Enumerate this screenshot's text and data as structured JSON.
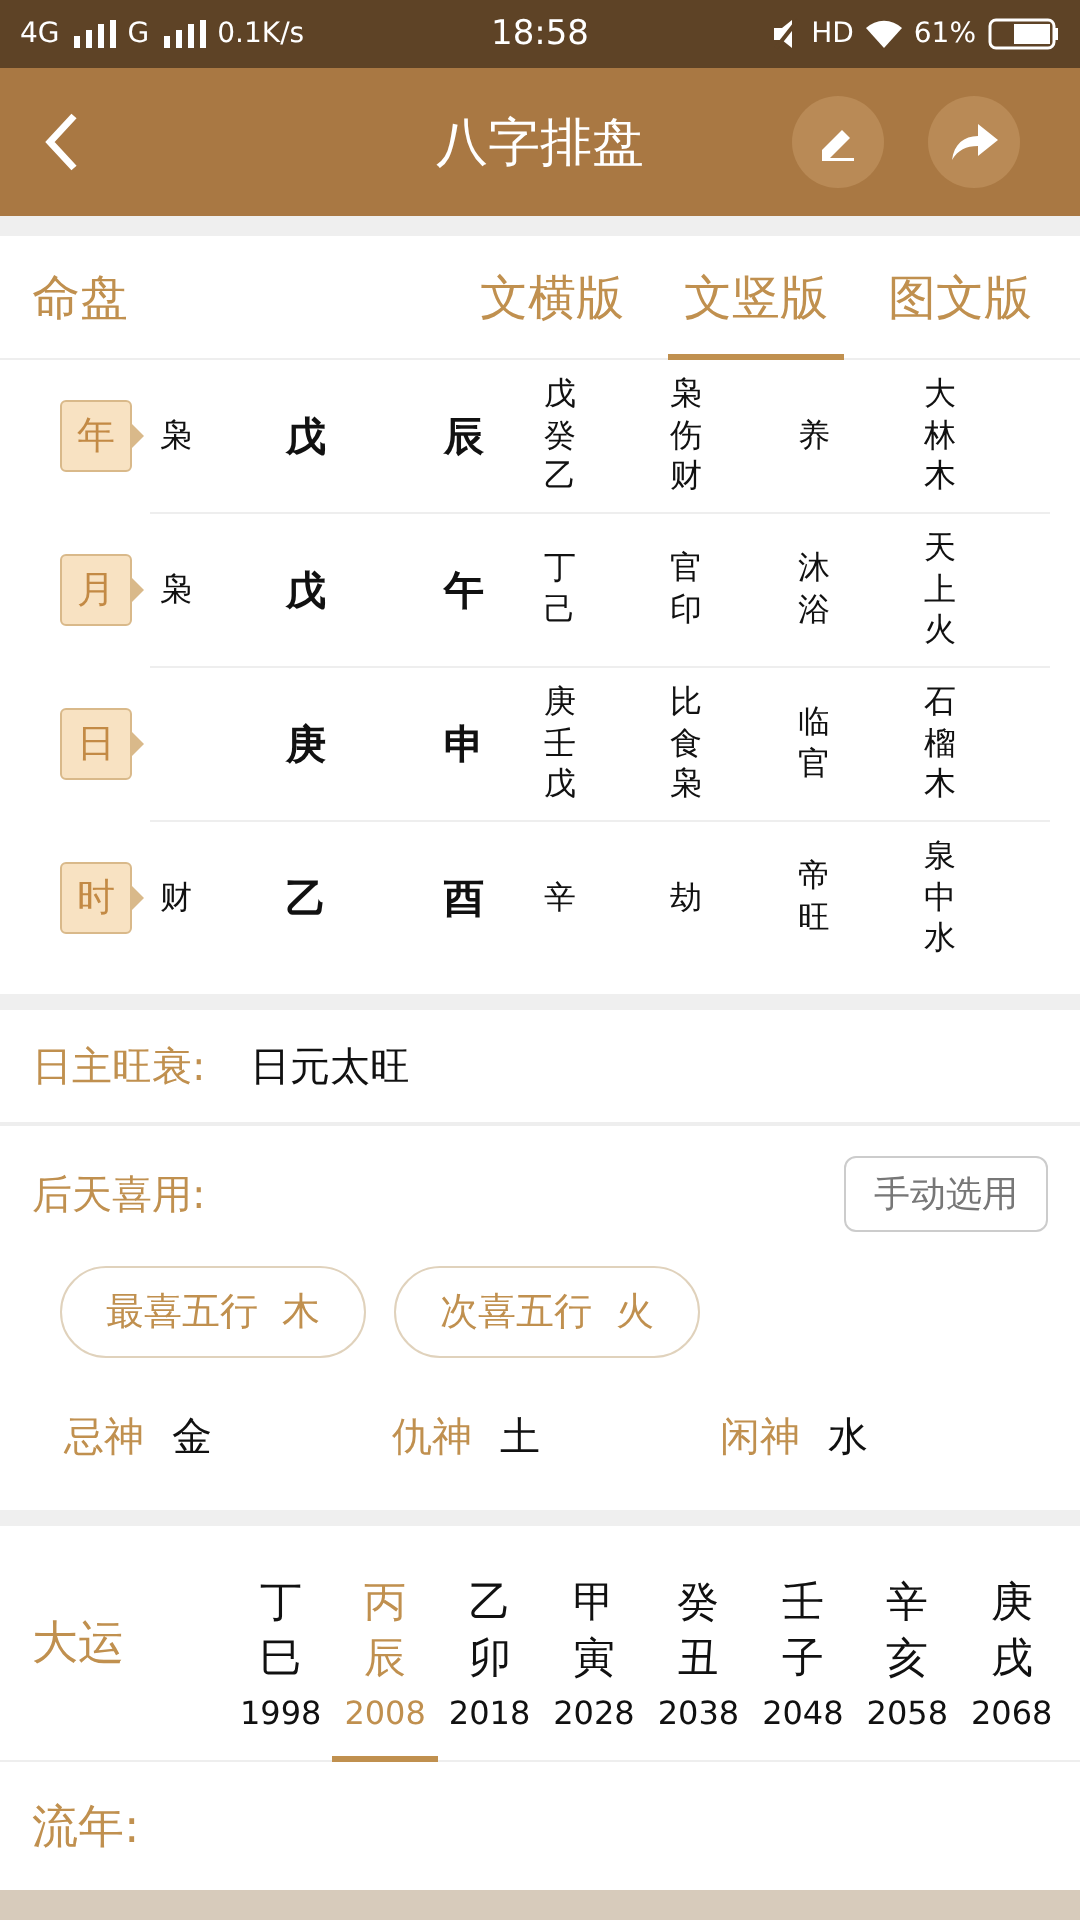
{
  "status_bar": {
    "network_1": "4G",
    "network_2": "G",
    "speed": "0.1K/s",
    "time": "18:58",
    "hd": "HD",
    "battery": "61%"
  },
  "header": {
    "title": "八字排盘"
  },
  "tabs": {
    "label": "命盘",
    "items": [
      {
        "label": "文横版",
        "selected": false
      },
      {
        "label": "文竖版",
        "selected": true
      },
      {
        "label": "图文版",
        "selected": false
      }
    ]
  },
  "chart": {
    "rows": [
      {
        "pillar": "年",
        "stem_god": "枭",
        "stem": "戊",
        "branch": "辰",
        "hidden_stems": "戊癸乙",
        "hidden_gods": "枭伤财",
        "growth": "养",
        "nayin": "大林木"
      },
      {
        "pillar": "月",
        "stem_god": "枭",
        "stem": "戊",
        "branch": "午",
        "hidden_stems": "丁己",
        "hidden_gods": "官印",
        "growth": "沐浴",
        "nayin": "天上火"
      },
      {
        "pillar": "日",
        "stem": "庚",
        "branch": "申",
        "hidden_stems": "庚壬戊",
        "hidden_gods": "比食枭",
        "growth": "临官",
        "nayin": "石榴木"
      },
      {
        "pillar": "时",
        "stem_god": "财",
        "stem": "乙",
        "branch": "酉",
        "hidden_stems": "辛",
        "hidden_gods": "劫",
        "growth": "帝旺",
        "nayin": "泉中水"
      }
    ]
  },
  "strength": {
    "label": "日主旺衰:",
    "value": "日元太旺"
  },
  "favorable": {
    "label": "后天喜用:",
    "button": "手动选用",
    "pills": [
      {
        "label": "最喜五行",
        "value": "木"
      },
      {
        "label": "次喜五行",
        "value": "火"
      }
    ],
    "gods": [
      {
        "label": "忌神",
        "value": "金"
      },
      {
        "label": "仇神",
        "value": "土"
      },
      {
        "label": "闲神",
        "value": "水"
      }
    ]
  },
  "dayun": {
    "label": "大运",
    "items": [
      {
        "stem": "丁",
        "branch": "巳",
        "year": "1998",
        "selected": false
      },
      {
        "stem": "丙",
        "branch": "辰",
        "year": "2008",
        "selected": true
      },
      {
        "stem": "乙",
        "branch": "卯",
        "year": "2018",
        "selected": false
      },
      {
        "stem": "甲",
        "branch": "寅",
        "year": "2028",
        "selected": false
      },
      {
        "stem": "癸",
        "branch": "丑",
        "year": "2038",
        "selected": false
      },
      {
        "stem": "壬",
        "branch": "子",
        "year": "2048",
        "selected": false
      },
      {
        "stem": "辛",
        "branch": "亥",
        "year": "2058",
        "selected": false
      },
      {
        "stem": "庚",
        "branch": "戌",
        "year": "2068",
        "selected": false
      }
    ]
  },
  "liunian": {
    "label": "流年:"
  }
}
